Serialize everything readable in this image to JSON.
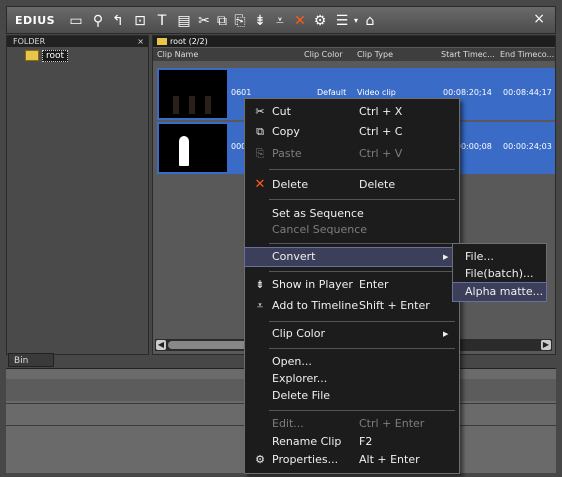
{
  "app": {
    "logo": "EDIUS",
    "close": "×"
  },
  "toolbar": {
    "icons": [
      "new-bin-icon",
      "search-icon",
      "up-folder-icon",
      "add-folder-icon",
      "title-icon",
      "color-bars-icon",
      "cut-icon",
      "copy-icon",
      "paste-icon",
      "add-to-player-icon",
      "add-to-timeline-icon",
      "delete-icon",
      "properties-icon",
      "view-icon",
      "dropdown-icon",
      "import-icon"
    ]
  },
  "folder": {
    "header": "FOLDER",
    "close": "×",
    "root_label": "root",
    "bin_tab": "Bin"
  },
  "clips": {
    "path": "root (2/2)",
    "columns": [
      "Clip Name",
      "Clip Color",
      "Clip Type",
      "Start Timec...",
      "End Timeco..."
    ],
    "rows": [
      {
        "name": "0601",
        "color": "Default",
        "type": "Video clip",
        "start": "00:08:20;14",
        "end": "00:08:44;17"
      },
      {
        "name": "0001",
        "color": "",
        "type": "",
        "start": "00:00:00;08",
        "end": "00:00:24;03"
      }
    ]
  },
  "menu": {
    "cut": {
      "label": "Cut",
      "shortcut": "Ctrl + X"
    },
    "copy": {
      "label": "Copy",
      "shortcut": "Ctrl + C"
    },
    "paste": {
      "label": "Paste",
      "shortcut": "Ctrl + V"
    },
    "delete": {
      "label": "Delete",
      "shortcut": "Delete"
    },
    "set_sequence": {
      "label": "Set as Sequence"
    },
    "cancel_sequence": {
      "label": "Cancel Sequence"
    },
    "convert": {
      "label": "Convert"
    },
    "show_player": {
      "label": "Show in Player",
      "shortcut": "Enter"
    },
    "add_timeline": {
      "label": "Add to Timeline",
      "shortcut": "Shift + Enter"
    },
    "clip_color": {
      "label": "Clip Color"
    },
    "open": {
      "label": "Open..."
    },
    "explorer": {
      "label": "Explorer..."
    },
    "delete_file": {
      "label": "Delete File"
    },
    "edit": {
      "label": "Edit...",
      "shortcut": "Ctrl + Enter"
    },
    "rename": {
      "label": "Rename Clip",
      "shortcut": "F2"
    },
    "properties": {
      "label": "Properties...",
      "shortcut": "Alt + Enter"
    }
  },
  "submenu": {
    "file": "File...",
    "file_batch": "File(batch)...",
    "alpha_matte": "Alpha matte..."
  },
  "colors": {
    "selection": "#3a6bc6",
    "menu_bg": "#1c1c1c",
    "highlight": "#3c3f5a"
  }
}
